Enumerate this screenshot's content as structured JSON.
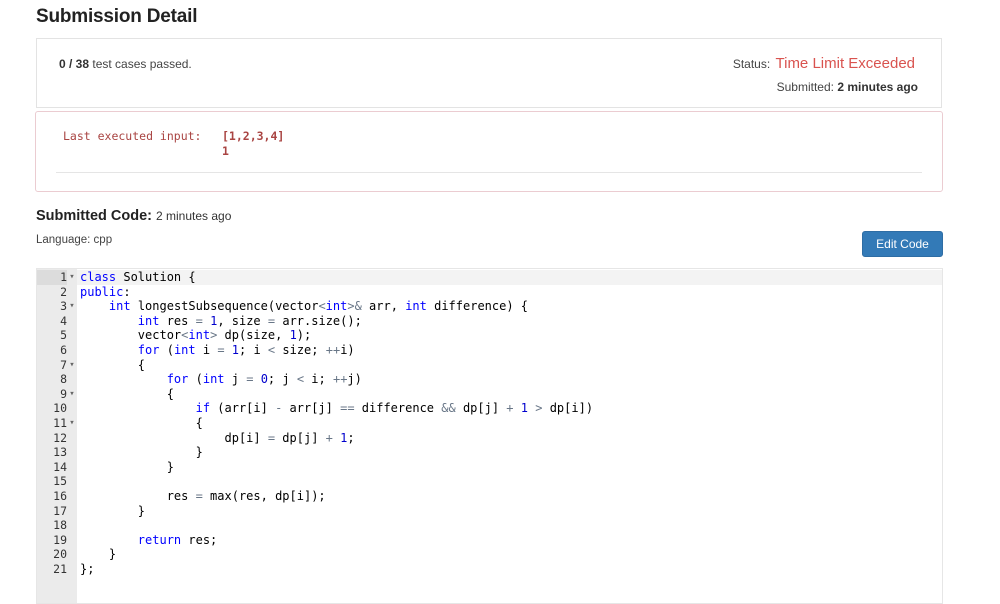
{
  "page": {
    "title": "Submission Detail"
  },
  "summary": {
    "passed_count": "0 / 38",
    "passed_suffix": " test cases passed.",
    "status_label": "Status: ",
    "status_value": "Time Limit Exceeded",
    "submitted_label": "Submitted: ",
    "submitted_value": "2 minutes ago"
  },
  "error": {
    "label": "Last executed input:",
    "inputs": [
      "[1,2,3,4]",
      "1"
    ]
  },
  "code_section": {
    "heading": "Submitted Code:",
    "time": "2 minutes ago",
    "language": "Language: cpp",
    "edit_button": "Edit Code"
  },
  "editor": {
    "active_line": 1,
    "fold_lines": [
      1,
      3,
      7,
      9,
      11
    ],
    "lines": [
      "class Solution {",
      "public:",
      "    int longestSubsequence(vector<int>& arr, int difference) {",
      "        int res = 1, size = arr.size();",
      "        vector<int> dp(size, 1);",
      "        for (int i = 1; i < size; ++i)",
      "        {",
      "            for (int j = 0; j < i; ++j)",
      "            {",
      "                if (arr[i] - arr[j] == difference && dp[j] + 1 > dp[i])",
      "                {",
      "                    dp[i] = dp[j] + 1;",
      "                }",
      "            }",
      "",
      "            res = max(res, dp[i]);",
      "        }",
      "",
      "        return res;",
      "    }",
      "};"
    ]
  }
}
